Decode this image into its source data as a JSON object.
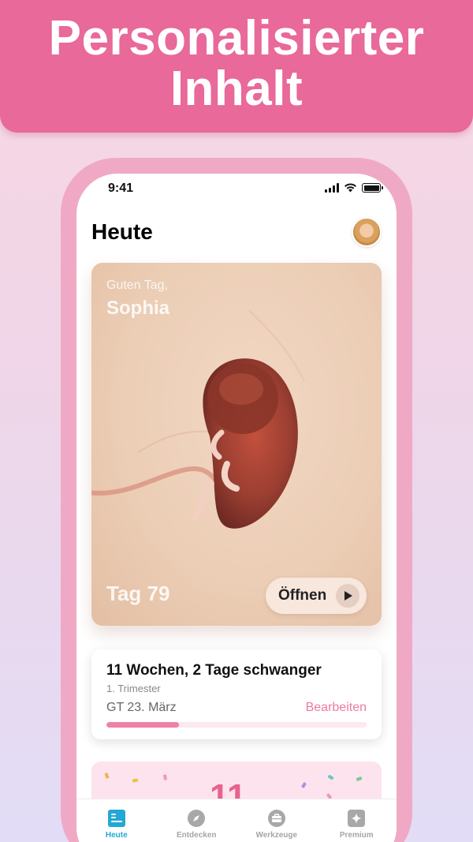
{
  "banner": {
    "title": "Personalisierter\nInhalt"
  },
  "status": {
    "time": "9:41"
  },
  "header": {
    "title": "Heute"
  },
  "hero": {
    "greeting": "Guten Tag,",
    "name": "Sophia",
    "day": "Tag 79",
    "open_label": "Öffnen"
  },
  "week_card": {
    "title": "11 Wochen, 2 Tage schwanger",
    "trimester": "1. Trimester",
    "due": "GT 23. März",
    "edit_label": "Bearbeiten",
    "progress_fraction": 0.28
  },
  "teaser": {
    "number": "11"
  },
  "tabs": [
    {
      "label": "Heute",
      "icon": "today-icon",
      "active": true
    },
    {
      "label": "Entdecken",
      "icon": "compass-icon",
      "active": false
    },
    {
      "label": "Werkzeuge",
      "icon": "toolbox-icon",
      "active": false
    },
    {
      "label": "Premium",
      "icon": "sparkle-icon",
      "active": false
    }
  ],
  "colors": {
    "brand_pink": "#e8699a",
    "active_tab": "#22a8d6",
    "progress": "#ee82a8"
  }
}
